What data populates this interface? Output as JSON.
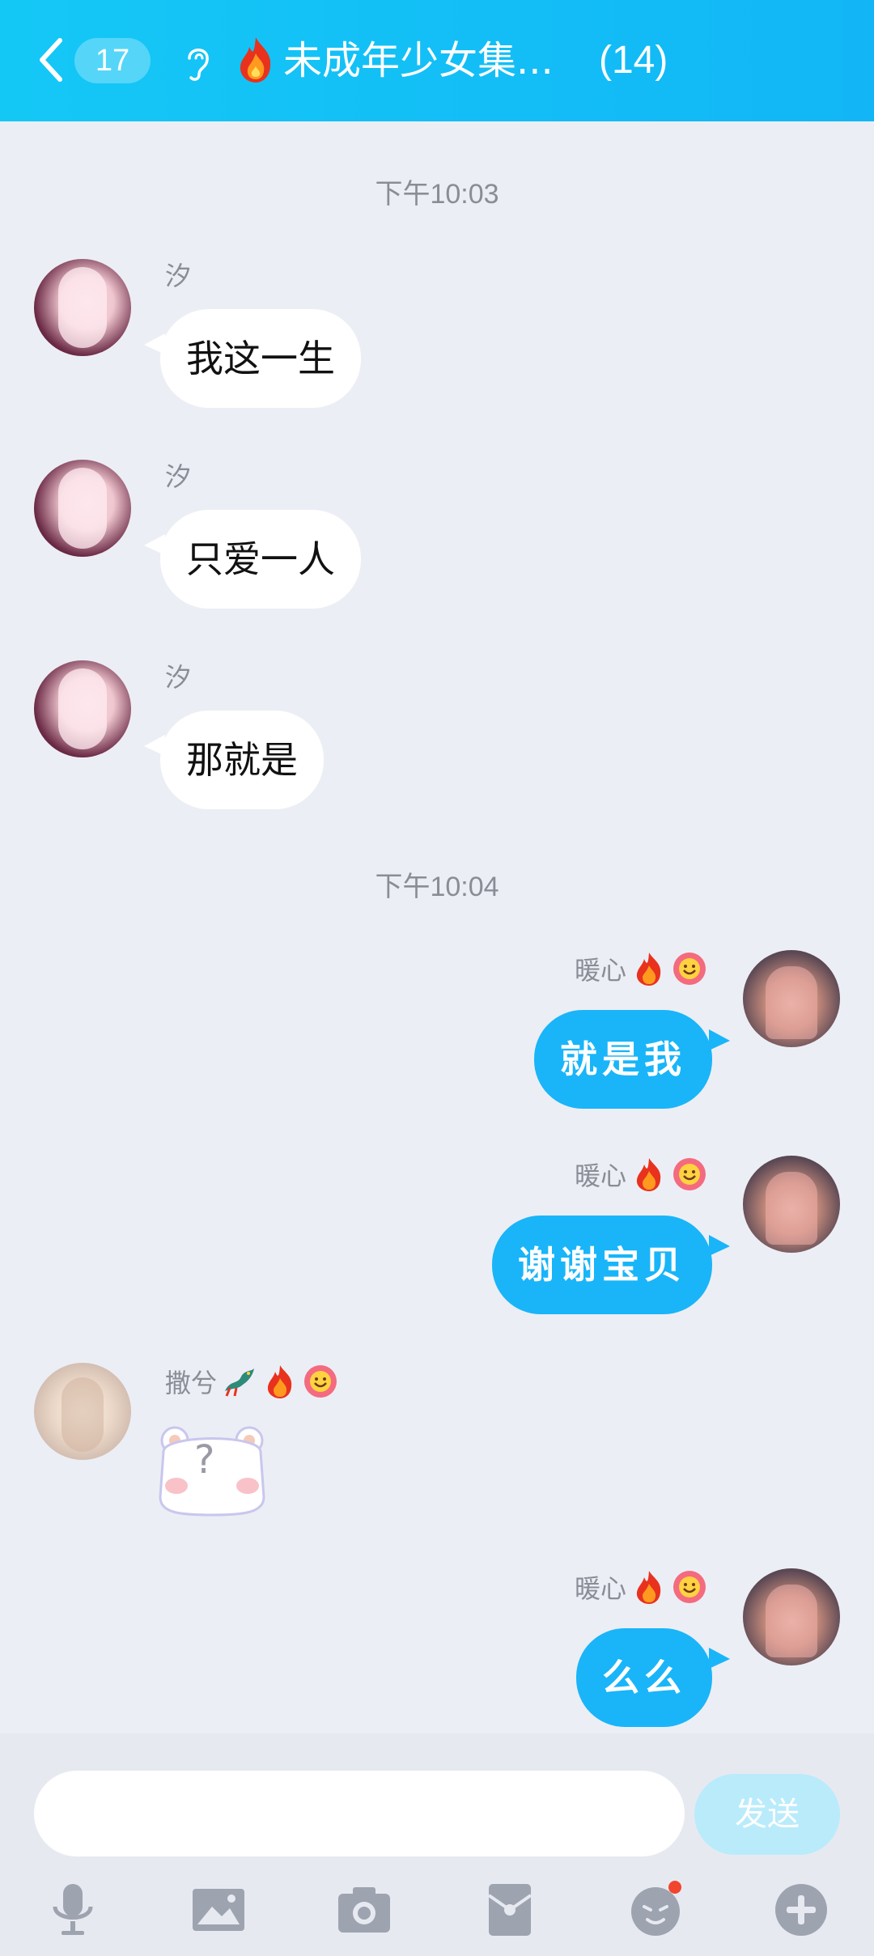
{
  "header": {
    "unread_count": "17",
    "title": "未成年少女集...",
    "member_count": "(14)",
    "back_icon": "chevron-left-icon",
    "ear_icon": "ear-icon",
    "fire_icon": "fire-icon"
  },
  "messages": {
    "time1": "下午10:03",
    "time2": "下午10:04",
    "m1": {
      "sender": "汐",
      "text": "我这一生"
    },
    "m2": {
      "sender": "汐",
      "text": "只爱一人"
    },
    "m3": {
      "sender": "汐",
      "text": "那就是"
    },
    "m4": {
      "sender": "暖心",
      "text": "就是我"
    },
    "m5": {
      "sender": "暖心",
      "text": "谢谢宝贝"
    },
    "m6": {
      "sender": "撒兮",
      "sticker_text": "?"
    },
    "m7": {
      "sender": "暖心",
      "text": "么么"
    }
  },
  "input": {
    "placeholder": "",
    "send_label": "发送"
  },
  "toolbar": [
    "mic-icon",
    "image-icon",
    "camera-icon",
    "red-packet-icon",
    "emoji-icon",
    "plus-icon"
  ],
  "colors": {
    "header_bg": "#14c8f6",
    "bubble_self": "#19b5f8",
    "bubble_other": "#ffffff",
    "chat_bg": "#eceef5",
    "send_btn": "#b9ebfb",
    "notify_dot": "#f2452e"
  }
}
